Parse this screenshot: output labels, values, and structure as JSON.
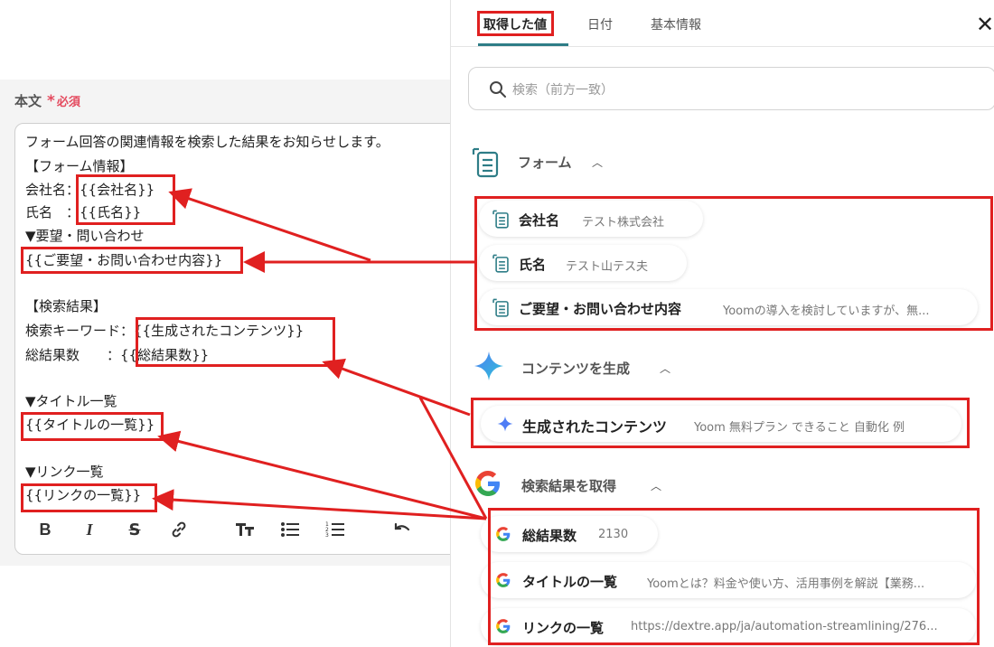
{
  "field": {
    "label": "本文",
    "required_star": "*",
    "required_text": "必須"
  },
  "message_lines": [
    "フォーム回答の関連情報を検索した結果をお知らせします。",
    "【フォーム情報】",
    "会社名：{{会社名}}",
    "氏名　：{{氏名}}",
    "▼要望・問い合わせ",
    "{{ご要望・お問い合わせ内容}}",
    "",
    "【検索結果】",
    "検索キーワード：{{生成されたコンテンツ}}",
    "総結果数　　：{{総結果数}}",
    "",
    "▼タイトル一覧",
    "{{タイトルの一覧}}",
    "",
    "▼リンク一覧",
    "{{リンクの一覧}}"
  ],
  "toolbar": {
    "bold": "B",
    "italic": "I",
    "strike": "S",
    "link": "link-icon",
    "heading": "text-size-icon",
    "bullet_list": "bullet-list-icon",
    "ordered_list": "numbered-list-icon",
    "undo": "undo-icon"
  },
  "panel": {
    "tabs": [
      "取得した値",
      "日付",
      "基本情報"
    ],
    "close": "✕",
    "search_placeholder": "検索（前方一致）",
    "sections": {
      "form": {
        "title": "フォーム",
        "items": [
          {
            "label": "会社名",
            "value": "テスト株式会社"
          },
          {
            "label": "氏名",
            "value": "テスト山テス夫"
          },
          {
            "label": "ご要望・お問い合わせ内容",
            "value": "Yoomの導入を検討していますが、無..."
          }
        ]
      },
      "ai": {
        "title": "コンテンツを生成",
        "items": [
          {
            "label": "生成されたコンテンツ",
            "value": "Yoom 無料プラン できること 自動化 例"
          }
        ]
      },
      "google": {
        "title": "検索結果を取得",
        "items": [
          {
            "label": "総結果数",
            "value": "2130"
          },
          {
            "label": "タイトルの一覧",
            "value": "Yoomとは？料金や使い方、活用事例を解説【業務..."
          },
          {
            "label": "リンクの一覧",
            "value": "https://dextre.app/ja/automation-streamlining/276..."
          }
        ]
      }
    }
  },
  "colors": {
    "annotation": "#e02020",
    "tab_underline": "#2e7d87",
    "required": "#e44a5e"
  }
}
